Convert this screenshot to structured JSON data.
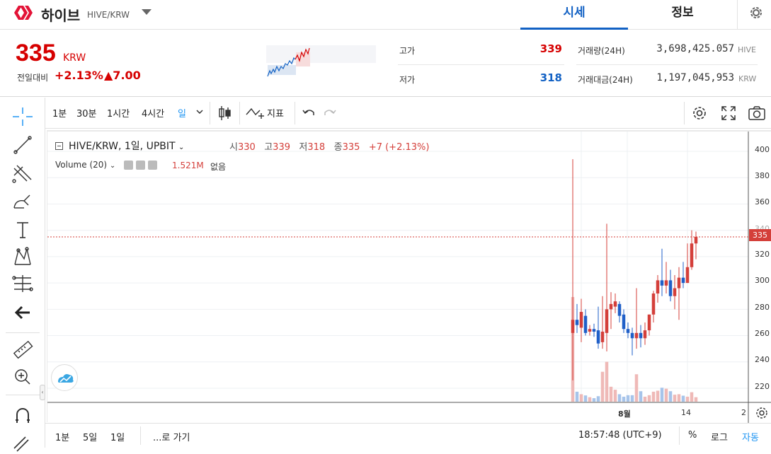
{
  "header": {
    "coin_name": "하이브",
    "coin_pair": "HIVE/KRW",
    "tabs": [
      {
        "label": "시세"
      },
      {
        "label": "정보"
      }
    ],
    "brand_color": "#1261c4"
  },
  "summary": {
    "price": "335",
    "price_unit": "KRW",
    "change_label": "전일대비",
    "change_rate": "+2.13%",
    "change_amount": "▲7.00",
    "high_label": "고가",
    "high_value": "339",
    "low_label": "저가",
    "low_value": "318",
    "volume_label": "거래량(24H)",
    "volume_value": "3,698,425.057",
    "volume_unit": "HIVE",
    "turnover_label": "거래대금(24H)",
    "turnover_value": "1,197,045,953",
    "turnover_unit": "KRW",
    "up_color": "#d60000",
    "down_color": "#1261c4"
  },
  "toolbar": {
    "intervals": [
      "1분",
      "30분",
      "1시간",
      "4시간",
      "일"
    ],
    "indicators_label": "지표"
  },
  "left_tools": [
    "crosshair-icon",
    "trendline-icon",
    "pitchfork-icon",
    "brush-icon",
    "text-icon",
    "pattern-icon",
    "fib-icon",
    "arrow-left-icon",
    "ruler-icon",
    "zoom-in-icon",
    "magnet-icon",
    "pencil-lock-icon"
  ],
  "legend": {
    "symbol": "HIVE/KRW, 1일, UPBIT",
    "open_k": "시",
    "open_v": "330",
    "high_k": "고",
    "high_v": "339",
    "low_k": "저",
    "low_v": "318",
    "close_k": "종",
    "close_v": "335",
    "change": "+7 (+2.13%)",
    "volume_label": "Volume (20)",
    "volume_value": "1.521M",
    "volume_none": "없음"
  },
  "yaxis_ticks": [
    "400",
    "380",
    "360",
    "340",
    "320",
    "300",
    "280",
    "260",
    "240",
    "220"
  ],
  "price_tag": "335",
  "xaxis_ticks": [
    "8월",
    "14",
    "2"
  ],
  "bottom": {
    "ranges": [
      "1분",
      "5일",
      "1일"
    ],
    "goto": "...로 가기",
    "time": "18:57:48 (UTC+9)",
    "percent": "%",
    "log": "로그",
    "auto": "자동"
  },
  "chart_data": {
    "type": "candlestick",
    "title": "HIVE/KRW, 1일, UPBIT",
    "ylim": [
      210,
      410
    ],
    "up_color": "#d43f3a",
    "down_color": "#1f5fc8",
    "candles": [
      {
        "o": 262,
        "h": 394,
        "l": 226,
        "c": 272
      },
      {
        "o": 272,
        "h": 284,
        "l": 262,
        "c": 268
      },
      {
        "o": 266,
        "h": 288,
        "l": 255,
        "c": 278
      },
      {
        "o": 275,
        "h": 280,
        "l": 260,
        "c": 262
      },
      {
        "o": 263,
        "h": 268,
        "l": 260,
        "c": 265
      },
      {
        "o": 265,
        "h": 269,
        "l": 259,
        "c": 263
      },
      {
        "o": 264,
        "h": 282,
        "l": 250,
        "c": 254
      },
      {
        "o": 255,
        "h": 290,
        "l": 250,
        "c": 263
      },
      {
        "o": 262,
        "h": 345,
        "l": 248,
        "c": 280
      },
      {
        "o": 280,
        "h": 293,
        "l": 265,
        "c": 284
      },
      {
        "o": 282,
        "h": 292,
        "l": 277,
        "c": 286
      },
      {
        "o": 284,
        "h": 286,
        "l": 270,
        "c": 275
      },
      {
        "o": 276,
        "h": 280,
        "l": 262,
        "c": 265
      },
      {
        "o": 265,
        "h": 270,
        "l": 258,
        "c": 262
      },
      {
        "o": 262,
        "h": 266,
        "l": 245,
        "c": 258
      },
      {
        "o": 258,
        "h": 296,
        "l": 250,
        "c": 262
      },
      {
        "o": 262,
        "h": 268,
        "l": 251,
        "c": 258
      },
      {
        "o": 258,
        "h": 270,
        "l": 253,
        "c": 264
      },
      {
        "o": 264,
        "h": 276,
        "l": 260,
        "c": 276
      },
      {
        "o": 276,
        "h": 294,
        "l": 270,
        "c": 292
      },
      {
        "o": 292,
        "h": 306,
        "l": 285,
        "c": 302
      },
      {
        "o": 302,
        "h": 326,
        "l": 290,
        "c": 298
      },
      {
        "o": 298,
        "h": 316,
        "l": 292,
        "c": 302
      },
      {
        "o": 302,
        "h": 310,
        "l": 286,
        "c": 290
      },
      {
        "o": 290,
        "h": 306,
        "l": 280,
        "c": 296
      },
      {
        "o": 296,
        "h": 312,
        "l": 272,
        "c": 304
      },
      {
        "o": 304,
        "h": 316,
        "l": 296,
        "c": 300
      },
      {
        "o": 300,
        "h": 330,
        "l": 300,
        "c": 312
      },
      {
        "o": 312,
        "h": 340,
        "l": 310,
        "c": 330
      },
      {
        "o": 330,
        "h": 339,
        "l": 318,
        "c": 335
      }
    ],
    "volume": [
      420,
      40,
      30,
      25,
      18,
      14,
      22,
      120,
      160,
      60,
      48,
      30,
      20,
      26,
      26,
      110,
      42,
      20,
      26,
      40,
      44,
      56,
      52,
      42,
      28,
      30,
      24,
      20,
      38,
      18
    ]
  }
}
